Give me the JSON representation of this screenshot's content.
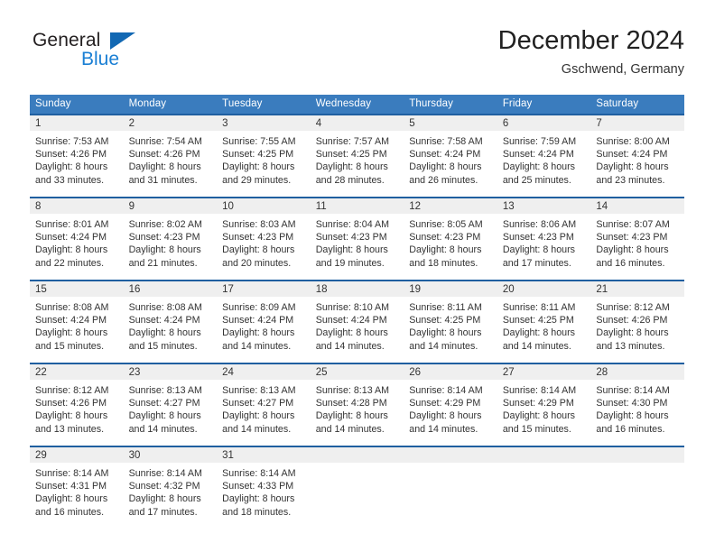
{
  "brand": {
    "name_top": "General",
    "name_bottom": "Blue",
    "color_dark": "#231f20",
    "color_blue": "#1a7fd4",
    "triangle_color": "#1268b3"
  },
  "header": {
    "title": "December 2024",
    "subtitle": "Gschwend, Germany"
  },
  "theme": {
    "header_bg": "#3a7cbe",
    "header_text": "#ffffff",
    "row_rule": "#1f5fa0",
    "daynum_bg": "#efefef",
    "body_text": "#333333"
  },
  "calendar": {
    "weekday_headers": [
      "Sunday",
      "Monday",
      "Tuesday",
      "Wednesday",
      "Thursday",
      "Friday",
      "Saturday"
    ],
    "weeks": [
      [
        {
          "day": "1",
          "sunrise": "Sunrise: 7:53 AM",
          "sunset": "Sunset: 4:26 PM",
          "daylight_line1": "Daylight: 8 hours",
          "daylight_line2": "and 33 minutes."
        },
        {
          "day": "2",
          "sunrise": "Sunrise: 7:54 AM",
          "sunset": "Sunset: 4:26 PM",
          "daylight_line1": "Daylight: 8 hours",
          "daylight_line2": "and 31 minutes."
        },
        {
          "day": "3",
          "sunrise": "Sunrise: 7:55 AM",
          "sunset": "Sunset: 4:25 PM",
          "daylight_line1": "Daylight: 8 hours",
          "daylight_line2": "and 29 minutes."
        },
        {
          "day": "4",
          "sunrise": "Sunrise: 7:57 AM",
          "sunset": "Sunset: 4:25 PM",
          "daylight_line1": "Daylight: 8 hours",
          "daylight_line2": "and 28 minutes."
        },
        {
          "day": "5",
          "sunrise": "Sunrise: 7:58 AM",
          "sunset": "Sunset: 4:24 PM",
          "daylight_line1": "Daylight: 8 hours",
          "daylight_line2": "and 26 minutes."
        },
        {
          "day": "6",
          "sunrise": "Sunrise: 7:59 AM",
          "sunset": "Sunset: 4:24 PM",
          "daylight_line1": "Daylight: 8 hours",
          "daylight_line2": "and 25 minutes."
        },
        {
          "day": "7",
          "sunrise": "Sunrise: 8:00 AM",
          "sunset": "Sunset: 4:24 PM",
          "daylight_line1": "Daylight: 8 hours",
          "daylight_line2": "and 23 minutes."
        }
      ],
      [
        {
          "day": "8",
          "sunrise": "Sunrise: 8:01 AM",
          "sunset": "Sunset: 4:24 PM",
          "daylight_line1": "Daylight: 8 hours",
          "daylight_line2": "and 22 minutes."
        },
        {
          "day": "9",
          "sunrise": "Sunrise: 8:02 AM",
          "sunset": "Sunset: 4:23 PM",
          "daylight_line1": "Daylight: 8 hours",
          "daylight_line2": "and 21 minutes."
        },
        {
          "day": "10",
          "sunrise": "Sunrise: 8:03 AM",
          "sunset": "Sunset: 4:23 PM",
          "daylight_line1": "Daylight: 8 hours",
          "daylight_line2": "and 20 minutes."
        },
        {
          "day": "11",
          "sunrise": "Sunrise: 8:04 AM",
          "sunset": "Sunset: 4:23 PM",
          "daylight_line1": "Daylight: 8 hours",
          "daylight_line2": "and 19 minutes."
        },
        {
          "day": "12",
          "sunrise": "Sunrise: 8:05 AM",
          "sunset": "Sunset: 4:23 PM",
          "daylight_line1": "Daylight: 8 hours",
          "daylight_line2": "and 18 minutes."
        },
        {
          "day": "13",
          "sunrise": "Sunrise: 8:06 AM",
          "sunset": "Sunset: 4:23 PM",
          "daylight_line1": "Daylight: 8 hours",
          "daylight_line2": "and 17 minutes."
        },
        {
          "day": "14",
          "sunrise": "Sunrise: 8:07 AM",
          "sunset": "Sunset: 4:23 PM",
          "daylight_line1": "Daylight: 8 hours",
          "daylight_line2": "and 16 minutes."
        }
      ],
      [
        {
          "day": "15",
          "sunrise": "Sunrise: 8:08 AM",
          "sunset": "Sunset: 4:24 PM",
          "daylight_line1": "Daylight: 8 hours",
          "daylight_line2": "and 15 minutes."
        },
        {
          "day": "16",
          "sunrise": "Sunrise: 8:08 AM",
          "sunset": "Sunset: 4:24 PM",
          "daylight_line1": "Daylight: 8 hours",
          "daylight_line2": "and 15 minutes."
        },
        {
          "day": "17",
          "sunrise": "Sunrise: 8:09 AM",
          "sunset": "Sunset: 4:24 PM",
          "daylight_line1": "Daylight: 8 hours",
          "daylight_line2": "and 14 minutes."
        },
        {
          "day": "18",
          "sunrise": "Sunrise: 8:10 AM",
          "sunset": "Sunset: 4:24 PM",
          "daylight_line1": "Daylight: 8 hours",
          "daylight_line2": "and 14 minutes."
        },
        {
          "day": "19",
          "sunrise": "Sunrise: 8:11 AM",
          "sunset": "Sunset: 4:25 PM",
          "daylight_line1": "Daylight: 8 hours",
          "daylight_line2": "and 14 minutes."
        },
        {
          "day": "20",
          "sunrise": "Sunrise: 8:11 AM",
          "sunset": "Sunset: 4:25 PM",
          "daylight_line1": "Daylight: 8 hours",
          "daylight_line2": "and 14 minutes."
        },
        {
          "day": "21",
          "sunrise": "Sunrise: 8:12 AM",
          "sunset": "Sunset: 4:26 PM",
          "daylight_line1": "Daylight: 8 hours",
          "daylight_line2": "and 13 minutes."
        }
      ],
      [
        {
          "day": "22",
          "sunrise": "Sunrise: 8:12 AM",
          "sunset": "Sunset: 4:26 PM",
          "daylight_line1": "Daylight: 8 hours",
          "daylight_line2": "and 13 minutes."
        },
        {
          "day": "23",
          "sunrise": "Sunrise: 8:13 AM",
          "sunset": "Sunset: 4:27 PM",
          "daylight_line1": "Daylight: 8 hours",
          "daylight_line2": "and 14 minutes."
        },
        {
          "day": "24",
          "sunrise": "Sunrise: 8:13 AM",
          "sunset": "Sunset: 4:27 PM",
          "daylight_line1": "Daylight: 8 hours",
          "daylight_line2": "and 14 minutes."
        },
        {
          "day": "25",
          "sunrise": "Sunrise: 8:13 AM",
          "sunset": "Sunset: 4:28 PM",
          "daylight_line1": "Daylight: 8 hours",
          "daylight_line2": "and 14 minutes."
        },
        {
          "day": "26",
          "sunrise": "Sunrise: 8:14 AM",
          "sunset": "Sunset: 4:29 PM",
          "daylight_line1": "Daylight: 8 hours",
          "daylight_line2": "and 14 minutes."
        },
        {
          "day": "27",
          "sunrise": "Sunrise: 8:14 AM",
          "sunset": "Sunset: 4:29 PM",
          "daylight_line1": "Daylight: 8 hours",
          "daylight_line2": "and 15 minutes."
        },
        {
          "day": "28",
          "sunrise": "Sunrise: 8:14 AM",
          "sunset": "Sunset: 4:30 PM",
          "daylight_line1": "Daylight: 8 hours",
          "daylight_line2": "and 16 minutes."
        }
      ],
      [
        {
          "day": "29",
          "sunrise": "Sunrise: 8:14 AM",
          "sunset": "Sunset: 4:31 PM",
          "daylight_line1": "Daylight: 8 hours",
          "daylight_line2": "and 16 minutes."
        },
        {
          "day": "30",
          "sunrise": "Sunrise: 8:14 AM",
          "sunset": "Sunset: 4:32 PM",
          "daylight_line1": "Daylight: 8 hours",
          "daylight_line2": "and 17 minutes."
        },
        {
          "day": "31",
          "sunrise": "Sunrise: 8:14 AM",
          "sunset": "Sunset: 4:33 PM",
          "daylight_line1": "Daylight: 8 hours",
          "daylight_line2": "and 18 minutes."
        },
        {
          "day": "",
          "sunrise": "",
          "sunset": "",
          "daylight_line1": "",
          "daylight_line2": "",
          "empty": true
        },
        {
          "day": "",
          "sunrise": "",
          "sunset": "",
          "daylight_line1": "",
          "daylight_line2": "",
          "empty": true
        },
        {
          "day": "",
          "sunrise": "",
          "sunset": "",
          "daylight_line1": "",
          "daylight_line2": "",
          "empty": true
        },
        {
          "day": "",
          "sunrise": "",
          "sunset": "",
          "daylight_line1": "",
          "daylight_line2": "",
          "empty": true
        }
      ]
    ]
  }
}
